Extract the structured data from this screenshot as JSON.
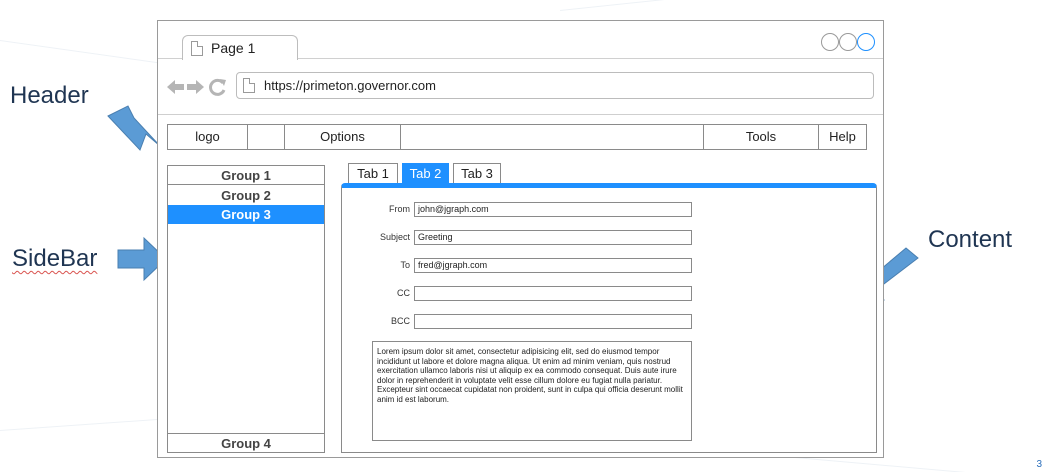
{
  "annotations": {
    "header": "Header",
    "sidebar": "SideBar",
    "content": "Content"
  },
  "browser": {
    "tab_label": "Page 1",
    "url": "https://primeton.governor.com"
  },
  "menu": {
    "logo": "logo",
    "options": "Options",
    "tools": "Tools",
    "help": "Help"
  },
  "sidebar": {
    "groups": [
      "Group 1",
      "Group 2",
      "Group 3",
      "Group 4"
    ],
    "selected": "Group 3"
  },
  "content": {
    "tabs": [
      "Tab 1",
      "Tab 2",
      "Tab 3"
    ],
    "active_tab": "Tab 2",
    "form": {
      "from_label": "From",
      "from_value": "john@jgraph.com",
      "subject_label": "Subject",
      "subject_value": "Greeting",
      "to_label": "To",
      "to_value": "fred@jgraph.com",
      "cc_label": "CC",
      "cc_value": "",
      "bcc_label": "BCC",
      "bcc_value": ""
    },
    "body": "Lorem ipsum dolor sit amet, consectetur adipisicing elit, sed do eiusmod tempor incididunt ut labore et dolore magna aliqua. Ut enim ad minim veniam, quis nostrud exercitation ullamco laboris nisi ut aliquip ex ea commodo consequat. Duis aute irure dolor in reprehenderit in voluptate velit esse cillum dolore eu fugiat nulla pariatur. Excepteur sint occaecat cupidatat non proident, sunt in culpa qui officia deserunt mollit anim id est laborum."
  },
  "corner_mark": "3",
  "colors": {
    "accent": "#1e90ff",
    "arrow": "#5b9bd5",
    "label": "#1f3552"
  },
  "icons": [
    "back-arrow-icon",
    "forward-arrow-icon",
    "refresh-icon",
    "page-icon"
  ]
}
